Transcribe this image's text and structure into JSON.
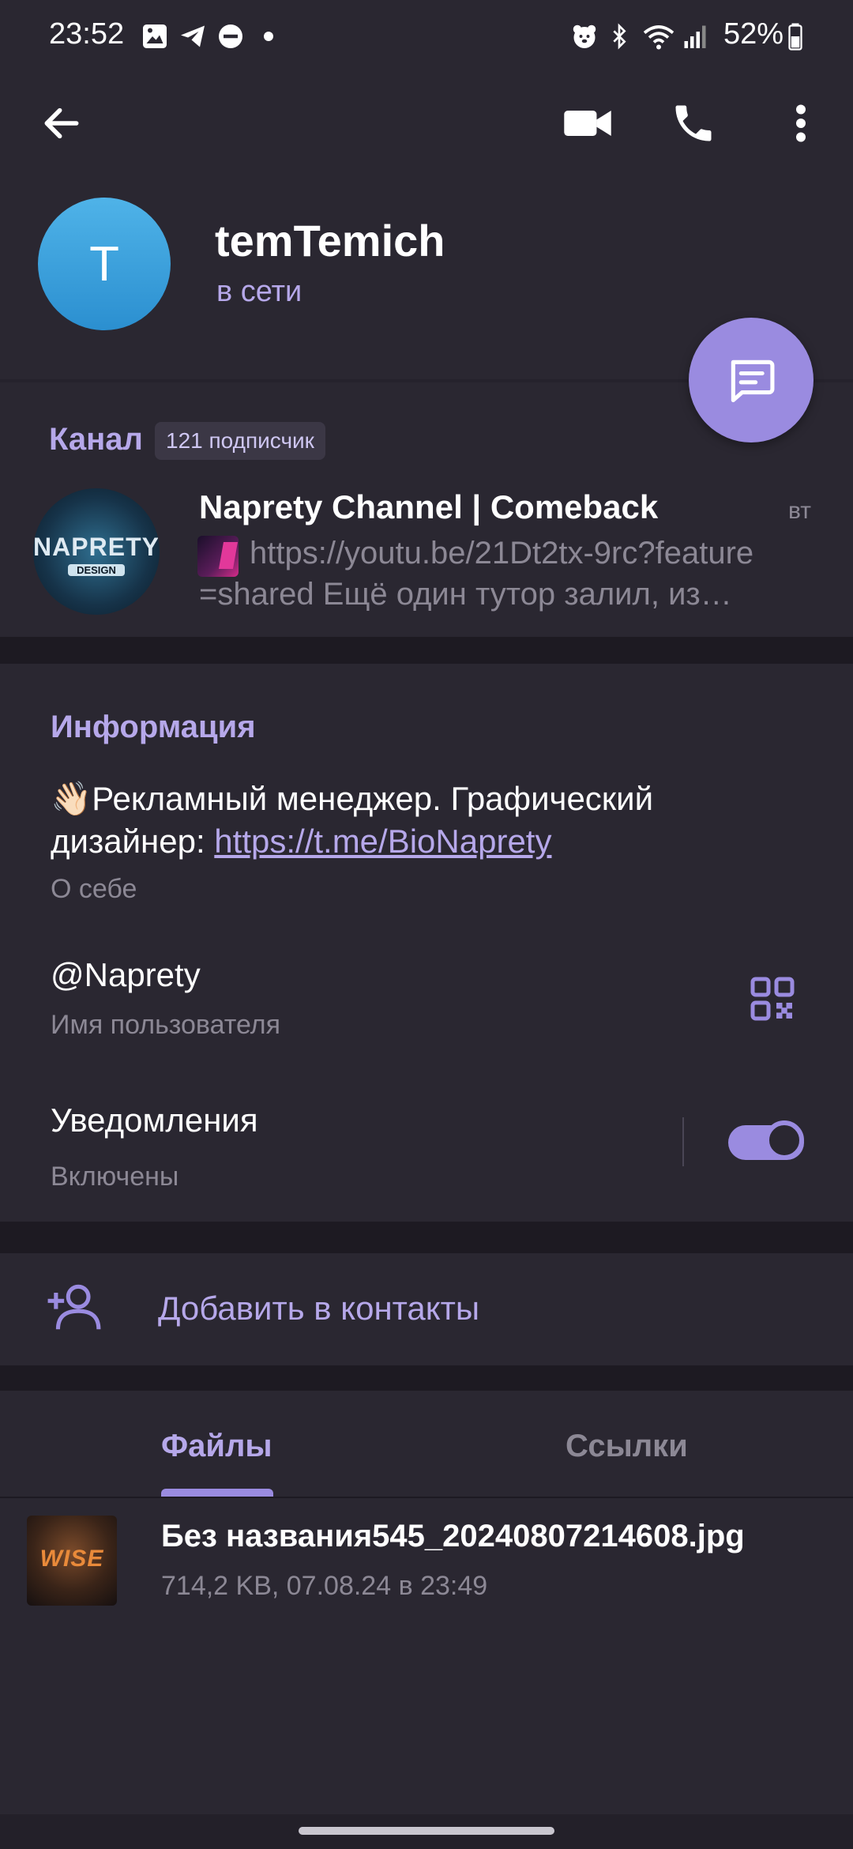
{
  "status_bar": {
    "time": "23:52",
    "battery": "52%"
  },
  "toolbar": {
    "back": "back-arrow-icon",
    "video": "video-camera-icon",
    "call": "phone-icon",
    "more": "more-vertical-icon"
  },
  "profile": {
    "avatar_letter": "T",
    "name": "temTemich",
    "status": "в сети"
  },
  "channel": {
    "section_label": "Канал",
    "subscribers": "121 подписчик",
    "title": "Naprety Channel | Comeback",
    "day": "вт",
    "preview_line1": "https://youtu.be/21Dt2tx-9rc?feature",
    "preview_line2": "=shared   Ещё один тутор залил, из…",
    "logo_text_top": "NAPRETY",
    "logo_text_bottom": "DESIGN"
  },
  "info": {
    "section_label": "Информация",
    "bio_emoji": "👋🏻",
    "bio_text": "Рекламный менеджер. Графический",
    "bio_text2": "дизайнер: ",
    "bio_link": "https://t.me/BioNaprety",
    "bio_caption": "О себе",
    "username": "@Naprety",
    "username_caption": "Имя пользователя",
    "notifications": "Уведомления",
    "notifications_caption": "Включены",
    "notifications_on": true
  },
  "add_contact": {
    "label": "Добавить в контакты"
  },
  "tabs": {
    "files": "Файлы",
    "links": "Ссылки",
    "active": "files"
  },
  "files": [
    {
      "name": "Без названия545_20240807214608.jpg",
      "meta": "714,2 KB, 07.08.24 в 23:49",
      "thumb_text": "WISE"
    }
  ],
  "colors": {
    "accent": "#9a8be0",
    "accent_text": "#b6a8ea",
    "background": "#2a2731",
    "divider": "#1d1a22"
  }
}
